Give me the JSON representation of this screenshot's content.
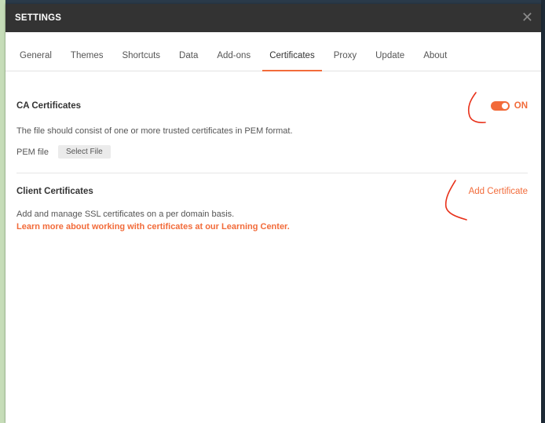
{
  "header": {
    "title": "SETTINGS",
    "close_icon": "close-icon"
  },
  "tabs": [
    {
      "label": "General",
      "active": false
    },
    {
      "label": "Themes",
      "active": false
    },
    {
      "label": "Shortcuts",
      "active": false
    },
    {
      "label": "Data",
      "active": false
    },
    {
      "label": "Add-ons",
      "active": false
    },
    {
      "label": "Certificates",
      "active": true
    },
    {
      "label": "Proxy",
      "active": false
    },
    {
      "label": "Update",
      "active": false
    },
    {
      "label": "About",
      "active": false
    }
  ],
  "ca": {
    "title": "CA Certificates",
    "toggle_state": "ON",
    "toggle_on": true,
    "description": "The file should consist of one or more trusted certificates in PEM format.",
    "pem_label": "PEM file",
    "select_file_label": "Select File"
  },
  "client": {
    "title": "Client Certificates",
    "add_label": "Add Certificate",
    "description": "Add and manage SSL certificates on a per domain basis.",
    "learn_more": "Learn more about working with certificates at our Learning Center."
  },
  "colors": {
    "accent": "#f26b3a",
    "header_bg": "#333333",
    "annotation": "#e8311a"
  }
}
